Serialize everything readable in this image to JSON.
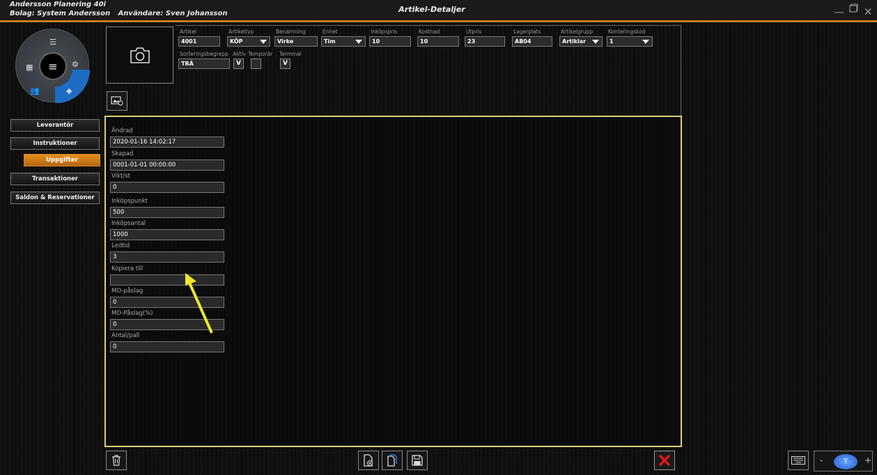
{
  "titlebar": {
    "app_name": "Andersson Planering 40i",
    "company_label": "Bolag:  System Andersson",
    "user_label": "Användare:  Sven Johansson",
    "window_title": "Artikel-Detaljer"
  },
  "sidebar": {
    "items": [
      {
        "label": "Leverantör"
      },
      {
        "label": "Instruktioner"
      },
      {
        "label": "Uppgifter"
      },
      {
        "label": "Transaktioner"
      },
      {
        "label": "Saldon & Reservationer"
      }
    ]
  },
  "header": {
    "artikel": {
      "label": "Artikel",
      "value": "4001"
    },
    "artikeltyp": {
      "label": "Artikeltyp",
      "value": "KÖP"
    },
    "benamning": {
      "label": "Benämning",
      "value": "Virke"
    },
    "enhet": {
      "label": "Enhet",
      "value": "Tim"
    },
    "inkopspris": {
      "label": "Inköpspris",
      "value": "10"
    },
    "kostnad": {
      "label": "Kostnad",
      "value": "10"
    },
    "utpris": {
      "label": "Utpris",
      "value": "23"
    },
    "lagerplats": {
      "label": "Lagerplats",
      "value": "AB04"
    },
    "artikelgrupp": {
      "label": "Artikelgrupp",
      "value": "Artiklar"
    },
    "konteringskod": {
      "label": "Konteringskod",
      "value": "1"
    },
    "sortering": {
      "label": "Sorteringsbegrepp",
      "value": "TRÄ"
    },
    "aktiv": {
      "label": "Aktiv",
      "checked": "V"
    },
    "temporar": {
      "label": "Temporär",
      "checked": ""
    },
    "terminal": {
      "label": "Terminal",
      "checked": "V"
    }
  },
  "details": [
    {
      "label": "Ändrad",
      "value": "2020-01-16 14:02:17"
    },
    {
      "label": "Skapad",
      "value": "0001-01-01 00:00:00"
    },
    {
      "label": "Vikt/st",
      "value": "0"
    },
    {
      "label": "Inköpspunkt",
      "value": "500"
    },
    {
      "label": "Inköpsantal",
      "value": "1000"
    },
    {
      "label": "Ledtid",
      "value": "3"
    },
    {
      "label": "Kopiera till",
      "value": ""
    },
    {
      "label": "MO-påslag",
      "value": "0"
    },
    {
      "label": "MO-Påslag(%)",
      "value": "0"
    },
    {
      "label": "Antal/pall",
      "value": "0"
    }
  ],
  "colors": {
    "accent": "#c97a1f",
    "panel_border": "#dcd07a",
    "active_nav": "#e6901f",
    "wheel_active": "#1f6cc4",
    "arrow": "#f2e82a",
    "close_red": "#e01818"
  },
  "icons": [
    "camera-icon",
    "image-settings-icon",
    "trash-icon",
    "new-doc-icon",
    "copy-doc-icon",
    "save-icon",
    "close-x-icon",
    "keyboard-icon"
  ],
  "zoom": {
    "minus": "-",
    "plus": "+",
    "thumb_text": "T"
  }
}
